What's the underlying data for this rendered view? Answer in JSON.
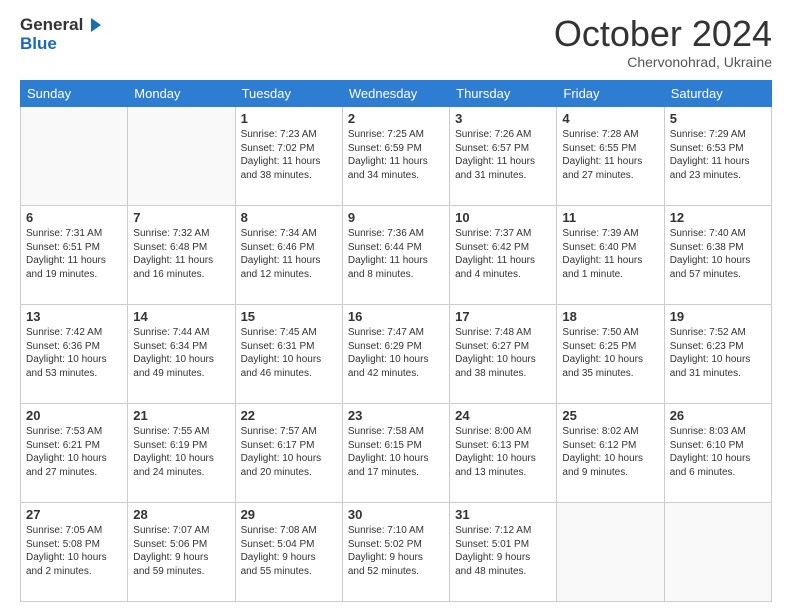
{
  "header": {
    "logo_line1": "General",
    "logo_line2": "Blue",
    "month": "October 2024",
    "location": "Chervonohrad, Ukraine"
  },
  "days": [
    "Sunday",
    "Monday",
    "Tuesday",
    "Wednesday",
    "Thursday",
    "Friday",
    "Saturday"
  ],
  "weeks": [
    [
      {
        "day": "",
        "content": ""
      },
      {
        "day": "",
        "content": ""
      },
      {
        "day": "1",
        "content": "Sunrise: 7:23 AM\nSunset: 7:02 PM\nDaylight: 11 hours\nand 38 minutes."
      },
      {
        "day": "2",
        "content": "Sunrise: 7:25 AM\nSunset: 6:59 PM\nDaylight: 11 hours\nand 34 minutes."
      },
      {
        "day": "3",
        "content": "Sunrise: 7:26 AM\nSunset: 6:57 PM\nDaylight: 11 hours\nand 31 minutes."
      },
      {
        "day": "4",
        "content": "Sunrise: 7:28 AM\nSunset: 6:55 PM\nDaylight: 11 hours\nand 27 minutes."
      },
      {
        "day": "5",
        "content": "Sunrise: 7:29 AM\nSunset: 6:53 PM\nDaylight: 11 hours\nand 23 minutes."
      }
    ],
    [
      {
        "day": "6",
        "content": "Sunrise: 7:31 AM\nSunset: 6:51 PM\nDaylight: 11 hours\nand 19 minutes."
      },
      {
        "day": "7",
        "content": "Sunrise: 7:32 AM\nSunset: 6:48 PM\nDaylight: 11 hours\nand 16 minutes."
      },
      {
        "day": "8",
        "content": "Sunrise: 7:34 AM\nSunset: 6:46 PM\nDaylight: 11 hours\nand 12 minutes."
      },
      {
        "day": "9",
        "content": "Sunrise: 7:36 AM\nSunset: 6:44 PM\nDaylight: 11 hours\nand 8 minutes."
      },
      {
        "day": "10",
        "content": "Sunrise: 7:37 AM\nSunset: 6:42 PM\nDaylight: 11 hours\nand 4 minutes."
      },
      {
        "day": "11",
        "content": "Sunrise: 7:39 AM\nSunset: 6:40 PM\nDaylight: 11 hours\nand 1 minute."
      },
      {
        "day": "12",
        "content": "Sunrise: 7:40 AM\nSunset: 6:38 PM\nDaylight: 10 hours\nand 57 minutes."
      }
    ],
    [
      {
        "day": "13",
        "content": "Sunrise: 7:42 AM\nSunset: 6:36 PM\nDaylight: 10 hours\nand 53 minutes."
      },
      {
        "day": "14",
        "content": "Sunrise: 7:44 AM\nSunset: 6:34 PM\nDaylight: 10 hours\nand 49 minutes."
      },
      {
        "day": "15",
        "content": "Sunrise: 7:45 AM\nSunset: 6:31 PM\nDaylight: 10 hours\nand 46 minutes."
      },
      {
        "day": "16",
        "content": "Sunrise: 7:47 AM\nSunset: 6:29 PM\nDaylight: 10 hours\nand 42 minutes."
      },
      {
        "day": "17",
        "content": "Sunrise: 7:48 AM\nSunset: 6:27 PM\nDaylight: 10 hours\nand 38 minutes."
      },
      {
        "day": "18",
        "content": "Sunrise: 7:50 AM\nSunset: 6:25 PM\nDaylight: 10 hours\nand 35 minutes."
      },
      {
        "day": "19",
        "content": "Sunrise: 7:52 AM\nSunset: 6:23 PM\nDaylight: 10 hours\nand 31 minutes."
      }
    ],
    [
      {
        "day": "20",
        "content": "Sunrise: 7:53 AM\nSunset: 6:21 PM\nDaylight: 10 hours\nand 27 minutes."
      },
      {
        "day": "21",
        "content": "Sunrise: 7:55 AM\nSunset: 6:19 PM\nDaylight: 10 hours\nand 24 minutes."
      },
      {
        "day": "22",
        "content": "Sunrise: 7:57 AM\nSunset: 6:17 PM\nDaylight: 10 hours\nand 20 minutes."
      },
      {
        "day": "23",
        "content": "Sunrise: 7:58 AM\nSunset: 6:15 PM\nDaylight: 10 hours\nand 17 minutes."
      },
      {
        "day": "24",
        "content": "Sunrise: 8:00 AM\nSunset: 6:13 PM\nDaylight: 10 hours\nand 13 minutes."
      },
      {
        "day": "25",
        "content": "Sunrise: 8:02 AM\nSunset: 6:12 PM\nDaylight: 10 hours\nand 9 minutes."
      },
      {
        "day": "26",
        "content": "Sunrise: 8:03 AM\nSunset: 6:10 PM\nDaylight: 10 hours\nand 6 minutes."
      }
    ],
    [
      {
        "day": "27",
        "content": "Sunrise: 7:05 AM\nSunset: 5:08 PM\nDaylight: 10 hours\nand 2 minutes."
      },
      {
        "day": "28",
        "content": "Sunrise: 7:07 AM\nSunset: 5:06 PM\nDaylight: 9 hours\nand 59 minutes."
      },
      {
        "day": "29",
        "content": "Sunrise: 7:08 AM\nSunset: 5:04 PM\nDaylight: 9 hours\nand 55 minutes."
      },
      {
        "day": "30",
        "content": "Sunrise: 7:10 AM\nSunset: 5:02 PM\nDaylight: 9 hours\nand 52 minutes."
      },
      {
        "day": "31",
        "content": "Sunrise: 7:12 AM\nSunset: 5:01 PM\nDaylight: 9 hours\nand 48 minutes."
      },
      {
        "day": "",
        "content": ""
      },
      {
        "day": "",
        "content": ""
      }
    ]
  ]
}
